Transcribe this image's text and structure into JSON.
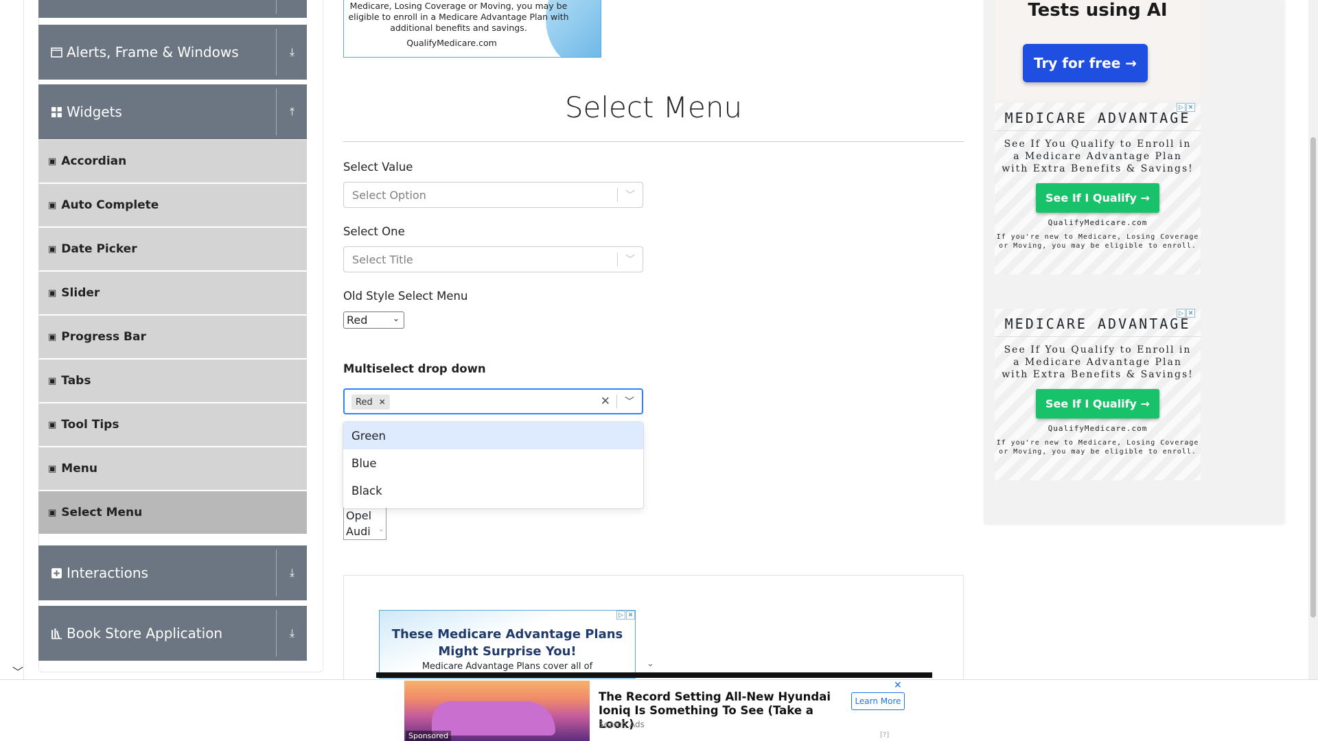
{
  "sidebar": {
    "groups": [
      {
        "label": "Alerts, Frame & Windows",
        "icon": "window-icon"
      },
      {
        "label": "Widgets",
        "icon": "grid-icon"
      },
      {
        "label": "Interactions",
        "icon": "interactions-icon"
      },
      {
        "label": "Book Store Application",
        "icon": "book-icon"
      }
    ],
    "widget_items": [
      "Accordian",
      "Auto Complete",
      "Date Picker",
      "Slider",
      "Progress Bar",
      "Tabs",
      "Tool Tips",
      "Menu",
      "Select Menu"
    ],
    "active_item": "Select Menu"
  },
  "top_ad": {
    "text": "Medicare, Losing Coverage or Moving, you may be eligible to enroll in a Medicare Advantage Plan with additional benefits and savings.",
    "url": "QualifyMedicare.com"
  },
  "main": {
    "title": "Select Menu",
    "select_value": {
      "label": "Select Value",
      "placeholder": "Select Option"
    },
    "select_one": {
      "label": "Select One",
      "placeholder": "Select Title"
    },
    "old_style": {
      "label": "Old Style Select Menu",
      "value": "Red"
    },
    "multiselect": {
      "label": "Multiselect drop down",
      "tags": [
        "Red"
      ],
      "options": [
        "Green",
        "Blue",
        "Black"
      ],
      "highlighted": "Green"
    },
    "cars_visible": [
      "Opel",
      "Audi"
    ]
  },
  "bottom_inline_ad": {
    "headline": "These Medicare Advantage Plans Might Surprise You!",
    "sub": "Medicare Advantage Plans cover all of"
  },
  "right_ads": {
    "ai": {
      "title": "Tests using AI",
      "button": "Try for free →"
    },
    "medicare": {
      "heading": "MEDICARE ADVANTAGE",
      "body": "See If You Qualify to Enroll in a Medicare Advantage Plan with Extra Benefits & Savings!",
      "button": "See If I Qualify →",
      "url": "QualifyMedicare.com",
      "fine": "If you're new to Medicare, Losing Coverage or Moving, you may be eligible to enroll."
    }
  },
  "bottom_bar": {
    "title": "The Record Setting All-New Hyundai Ioniq Is Something To See (Take a Look)",
    "source": "Search Ads",
    "button": "Learn More",
    "sponsored": "Sponsored",
    "info": "[?]"
  }
}
